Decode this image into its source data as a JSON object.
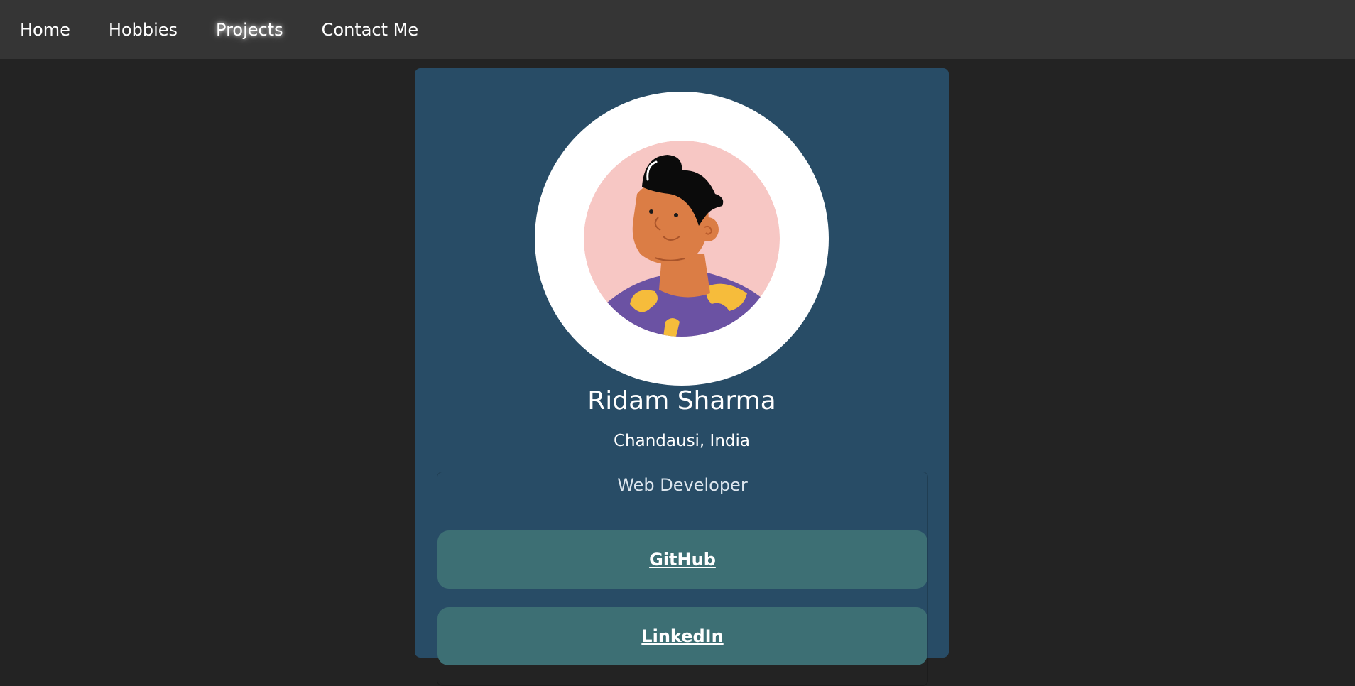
{
  "nav": {
    "items": [
      {
        "label": "Home"
      },
      {
        "label": "Hobbies"
      },
      {
        "label": "Projects"
      },
      {
        "label": "Contact Me"
      }
    ]
  },
  "profile": {
    "name": "Ridam Sharma",
    "location": "Chandausi, India",
    "role": "Web Developer",
    "avatar_icon": "boy-avatar-illustration"
  },
  "links": [
    {
      "label": "GitHub"
    },
    {
      "label": "LinkedIn"
    }
  ],
  "colors": {
    "page_bg": "#232323",
    "nav_bg": "#353535",
    "card_bg": "#284c66",
    "button_bg": "#3d6f74"
  }
}
